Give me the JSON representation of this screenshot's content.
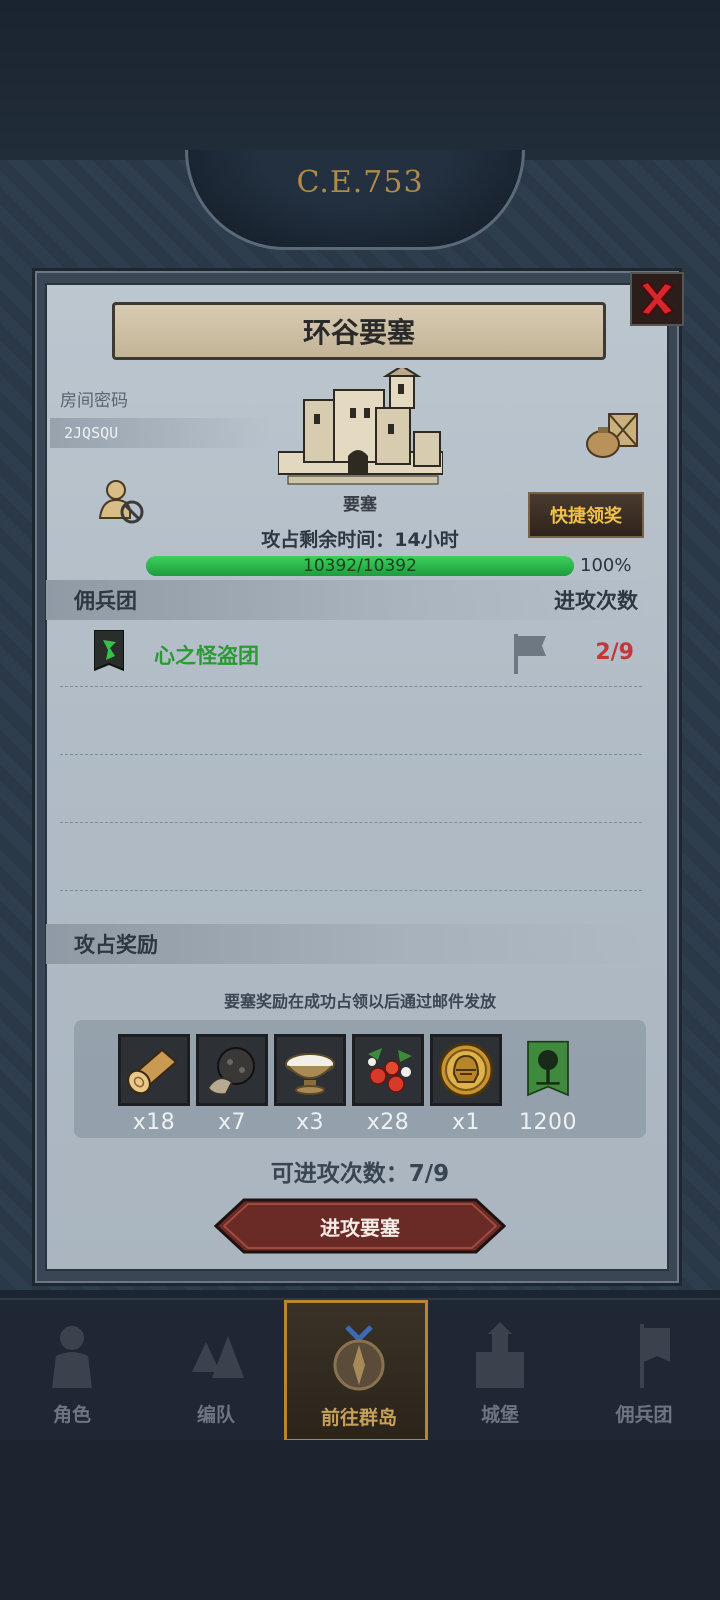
{
  "era": "C.E.753",
  "dialog": {
    "title": "环谷要塞",
    "room_code_label": "房间密码",
    "room_code": "2JQSQU",
    "fort_label": "要塞",
    "quick_claim_label": "快捷领奖",
    "time_remaining": "攻占剩余时间：14小时",
    "hp": {
      "text": "10392/10392",
      "percent_text": "100%",
      "fill_fraction": 1.0
    },
    "merc_section": {
      "label": "佣兵团",
      "right_label": "进攻次数"
    },
    "mercenaries": [
      {
        "name": "心之怪盗团",
        "attacks": "2/9"
      }
    ],
    "reward_section": {
      "label": "攻占奖励"
    },
    "reward_note": "要塞奖励在成功占领以后通过邮件发放",
    "rewards": [
      {
        "icon": "wood-log-icon",
        "count": "x18"
      },
      {
        "icon": "truffle-icon",
        "count": "x7"
      },
      {
        "icon": "milk-bowl-icon",
        "count": "x3"
      },
      {
        "icon": "berries-icon",
        "count": "x28"
      },
      {
        "icon": "helmet-coin-icon",
        "count": "x1"
      },
      {
        "icon": "guild-banner-icon",
        "count": "1200"
      }
    ],
    "attempts_left": "可进攻次数：7/9",
    "attack_button": "进攻要塞"
  },
  "bottom_nav": [
    {
      "label": "角色",
      "icon": "knight-icon",
      "active": false
    },
    {
      "label": "编队",
      "icon": "squad-icon",
      "active": false
    },
    {
      "label": "前往群岛",
      "icon": "compass-icon",
      "active": true
    },
    {
      "label": "城堡",
      "icon": "castle-icon",
      "active": false
    },
    {
      "label": "佣兵团",
      "icon": "mercenary-icon",
      "active": false
    }
  ],
  "colors": {
    "hp_green": "#2fbe4d",
    "merc_name": "#2b9a35",
    "attack_count": "#c23838",
    "quick_btn_text": "#f0c04a",
    "nav_active": "#b8862e"
  }
}
